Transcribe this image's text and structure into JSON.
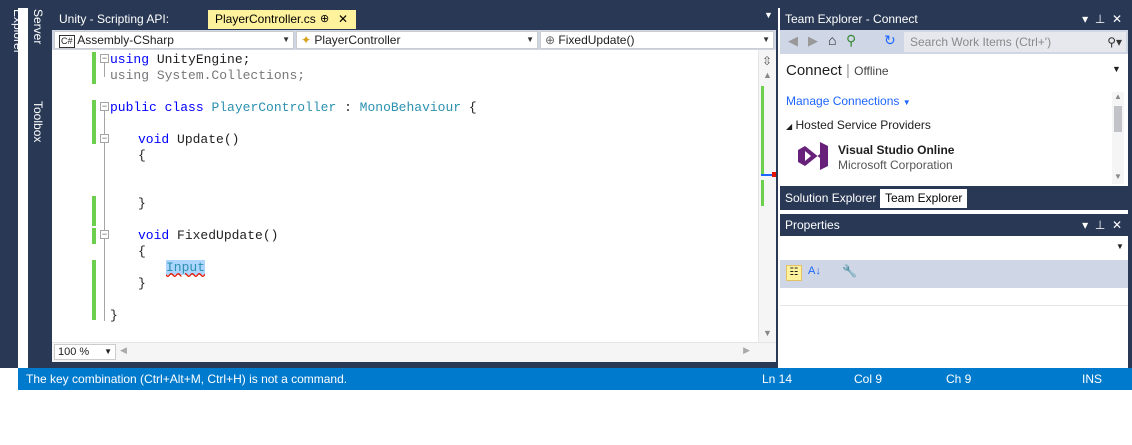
{
  "side_tabs": [
    "Server Explorer",
    "Toolbox"
  ],
  "editor": {
    "tabs": [
      {
        "label": "Unity - Scripting API:"
      },
      {
        "label": "PlayerController.cs",
        "pin": "⊕",
        "close": "✕"
      }
    ],
    "nav": {
      "project": "Assembly-CSharp",
      "project_badge": "C#",
      "class": "PlayerController",
      "member": "FixedUpdate()"
    },
    "code_lines": [
      {
        "kw": "using",
        "rest": " UnityEngine;"
      },
      {
        "kw": "using",
        "rest": " System.Collections;"
      },
      {
        "kw": "public class",
        "type": "PlayerController",
        "rest": " : ",
        "type2": "MonoBehaviour",
        "tail": " {"
      },
      {
        "kw": "void",
        "rest": " Update()"
      },
      {
        "rest": "{"
      },
      {
        "rest": "}"
      },
      {
        "kw": "void",
        "rest": " FixedUpdate()"
      },
      {
        "rest": "{"
      },
      {
        "typed": "Input"
      },
      {
        "rest": "}"
      },
      {
        "rest": "}"
      }
    ],
    "zoom": "100 %"
  },
  "status": {
    "message": "The key combination (Ctrl+Alt+M, Ctrl+H) is not a command.",
    "ln": "Ln 14",
    "col": "Col 9",
    "ch": "Ch 9",
    "mode": "INS"
  },
  "team_explorer": {
    "title": "Team Explorer - Connect",
    "search_placeholder": "Search Work Items (Ctrl+')",
    "connect": "Connect",
    "offline": "Offline",
    "manage": "Manage Connections",
    "hosted": "Hosted Service Providers",
    "vso_name": "Visual Studio Online",
    "vso_company": "Microsoft Corporation",
    "accent": "#68217a"
  },
  "bottom_tabs": [
    "Solution Explorer",
    "Team Explorer"
  ],
  "properties": {
    "title": "Properties"
  }
}
